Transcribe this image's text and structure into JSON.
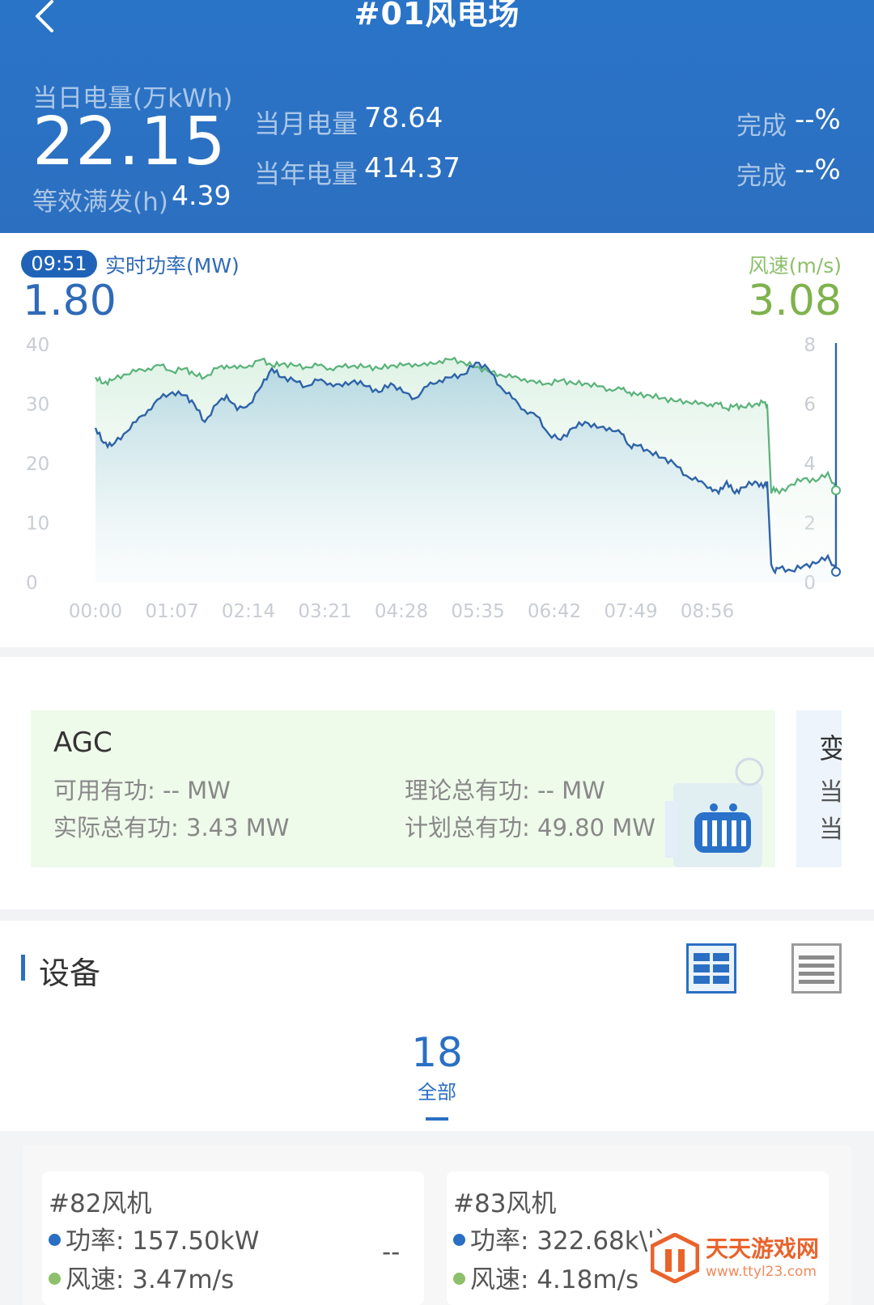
{
  "header": {
    "title": "#01风电场",
    "day_label": "当日电量(万kWh)",
    "day_value": "22.15",
    "eq_label": "等效满发(h)",
    "eq_value": "4.39",
    "month_label": "当月电量",
    "month_value": "78.64",
    "year_label": "当年电量",
    "year_value": "414.37",
    "done_label": "完成",
    "month_done": "--%",
    "year_done": "--%"
  },
  "realtime": {
    "time": "09:51",
    "power_label": "实时功率(MW)",
    "power_value": "1.80",
    "wind_label": "风速(m/s)",
    "wind_value": "3.08"
  },
  "chart_data": {
    "type": "line",
    "x_ticks": [
      "00:00",
      "01:07",
      "02:14",
      "03:21",
      "04:28",
      "05:35",
      "06:42",
      "07:49",
      "08:56"
    ],
    "y_left": {
      "range": [
        0,
        40
      ],
      "ticks": [
        0,
        10,
        20,
        30,
        40
      ]
    },
    "y_right": {
      "range": [
        0,
        8
      ],
      "ticks": [
        0,
        2,
        4,
        6,
        8
      ]
    },
    "colors": {
      "power": "#2f63a8",
      "wind": "#59b27a"
    },
    "series": [
      {
        "axis": "left",
        "x": [
          0,
          10,
          20,
          35,
          50,
          65,
          80,
          95,
          110,
          122,
          135,
          150,
          162,
          175,
          190,
          205,
          218,
          230,
          245,
          260,
          275,
          290,
          305,
          320,
          335,
          350,
          365,
          380,
          395,
          410,
          425,
          440,
          455,
          470,
          485,
          500,
          515,
          530,
          545,
          560,
          575,
          590,
          605,
          620,
          635,
          650,
          660,
          670,
          685,
          700,
          715,
          730,
          745,
          760,
          770,
          780,
          790,
          800,
          815,
          825,
          830,
          835,
          838,
          845,
          860,
          875,
          890,
          905,
          915
        ],
        "y": [
          26,
          23.5,
          23,
          25,
          27,
          29,
          31,
          32,
          31.5,
          30,
          27,
          30,
          31.5,
          29,
          30,
          33,
          36,
          34.5,
          34,
          33,
          34,
          33.5,
          33,
          34,
          33,
          32,
          33.5,
          32,
          31,
          33,
          34,
          34.5,
          35,
          37,
          36,
          33,
          31,
          29,
          28,
          25,
          24,
          26,
          27,
          26,
          26,
          25,
          23,
          23,
          22,
          21,
          20,
          18,
          17,
          16,
          15,
          17,
          15,
          16,
          17,
          16,
          17,
          3,
          2,
          2.4,
          2,
          2.8,
          3.2,
          4.5,
          1.8
        ]
      },
      {
        "axis": "right",
        "x": [
          0,
          10,
          20,
          35,
          50,
          65,
          80,
          95,
          110,
          122,
          135,
          150,
          162,
          175,
          190,
          205,
          218,
          230,
          245,
          260,
          275,
          290,
          305,
          320,
          335,
          350,
          365,
          380,
          395,
          410,
          425,
          440,
          455,
          470,
          485,
          500,
          515,
          530,
          545,
          560,
          575,
          590,
          605,
          620,
          635,
          650,
          660,
          670,
          685,
          700,
          715,
          730,
          745,
          760,
          770,
          780,
          790,
          800,
          815,
          825,
          830,
          835,
          838,
          845,
          860,
          875,
          890,
          905,
          915
        ],
        "y": [
          6.9,
          6.7,
          6.8,
          7,
          7.1,
          7.2,
          7.3,
          7.1,
          7.2,
          7,
          6.9,
          7.2,
          7.3,
          7.2,
          7.3,
          7.5,
          7.3,
          7.35,
          7.3,
          7.25,
          7.3,
          7.2,
          7.25,
          7.3,
          7.25,
          7.2,
          7.3,
          7.3,
          7.35,
          7.3,
          7.45,
          7.5,
          7.4,
          7.25,
          7.1,
          7.0,
          6.9,
          6.85,
          6.7,
          6.7,
          6.8,
          6.7,
          6.7,
          6.6,
          6.5,
          6.5,
          6.4,
          6.3,
          6.3,
          6.2,
          6.1,
          6.1,
          6.0,
          6.0,
          6.0,
          5.85,
          5.95,
          5.9,
          6.0,
          6.05,
          6.0,
          3.0,
          3.2,
          3.0,
          3.3,
          3.5,
          3.4,
          3.7,
          3.1
        ]
      }
    ]
  },
  "agc": {
    "title": "AGC",
    "available": "可用有功: -- MW",
    "theory": "理论总有功: -- MW",
    "actual": "实际总有功: 3.43 MW",
    "plan": "计划总有功: 49.80 MW",
    "side_title": "变",
    "side_line1": "当",
    "side_line2": "当"
  },
  "devices": {
    "title": "设备",
    "count": "18",
    "count_label": "全部",
    "items": [
      {
        "name": "#82风机",
        "power": "功率: 157.50kW",
        "wind": "风速: 3.47m/s",
        "status": "--"
      },
      {
        "name": "#83风机",
        "power": "功率: 322.68k\\'`",
        "wind": "风速: 4.18m/s"
      }
    ]
  },
  "watermark": {
    "text": "天天游戏网",
    "url": "www.ttyl23.com"
  }
}
